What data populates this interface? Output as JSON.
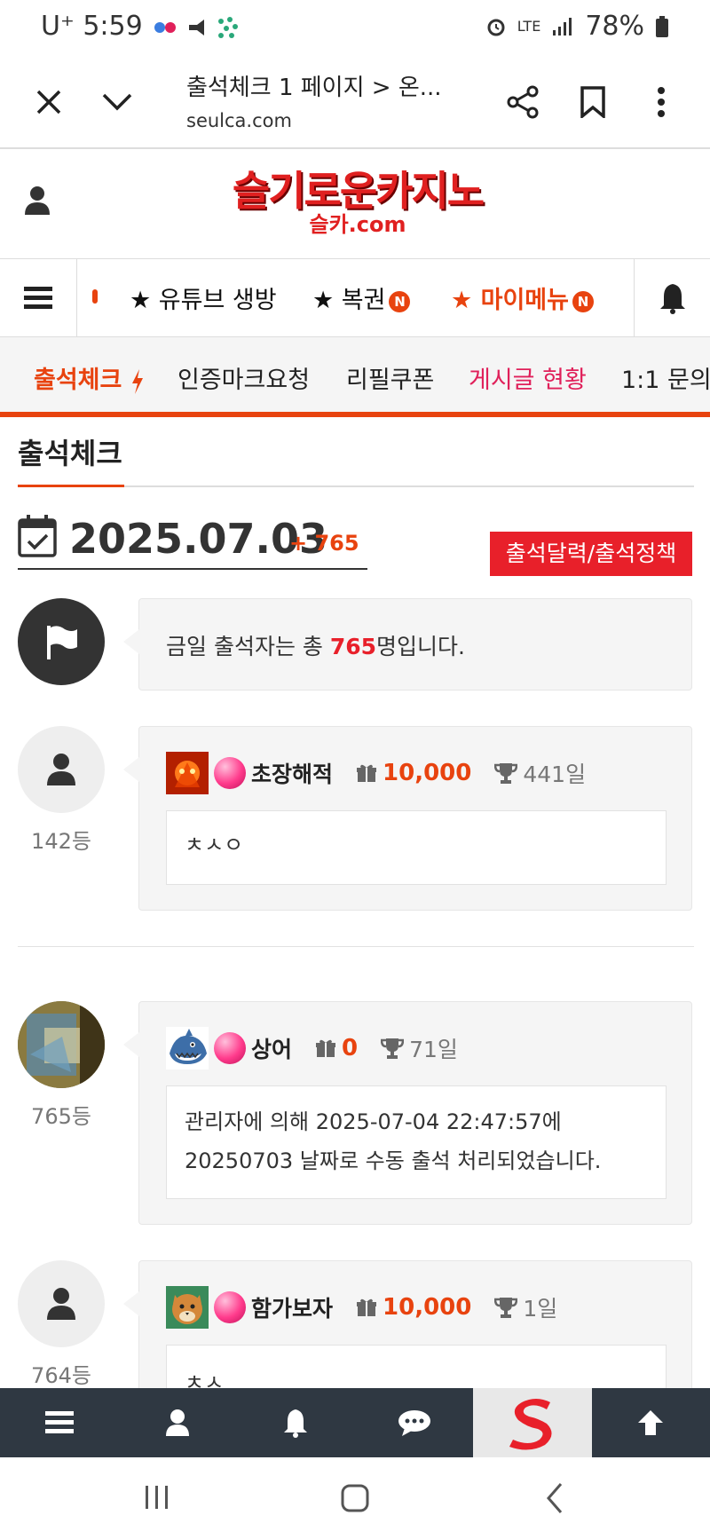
{
  "status_bar": {
    "carrier": "U⁺",
    "time": "5:59",
    "network": "LTE",
    "battery": "78%"
  },
  "browser": {
    "tab_title": "출석체크 1 페이지 > 온...",
    "url": "seulca.com"
  },
  "logo": {
    "line1": "슬기로운카지노",
    "line2": "슬카.com"
  },
  "menu": {
    "items": [
      {
        "label": "★ 유튜브 생방",
        "badge": ""
      },
      {
        "label": "★ 복권",
        "badge": "N"
      },
      {
        "label": "★ 마이메뉴",
        "badge": "N"
      }
    ]
  },
  "tabs": [
    "출석체크",
    "인증마크요청",
    "리필쿠폰",
    "게시글 현황",
    "1:1 문의"
  ],
  "section_title": "출석체크",
  "date": {
    "value": "2025.07.03",
    "plus": "+ 765"
  },
  "calendar_button": "출석달력/출석정책",
  "summary": {
    "prefix": "금일 출석자는 총 ",
    "count": "765",
    "suffix": "명입니다."
  },
  "posts": [
    {
      "rank": "142등",
      "nickname": "초장해적",
      "points": "10,000",
      "days": "441일",
      "message": "ㅊㅅㅇ"
    },
    {
      "rank": "765등",
      "nickname": "상어",
      "points": "0",
      "days": "71일",
      "message_line1": "관리자에 의해 2025-07-04 22:47:57에",
      "message_line2": "20250703 날짜로 수동 출석 처리되었습니다."
    },
    {
      "rank": "764등",
      "nickname": "함가보자",
      "points": "10,000",
      "days": "1일",
      "message": "ㅊㅅ"
    }
  ],
  "colors": {
    "accent": "#e8430f",
    "red": "#e8202a",
    "dark": "#2f3842"
  }
}
